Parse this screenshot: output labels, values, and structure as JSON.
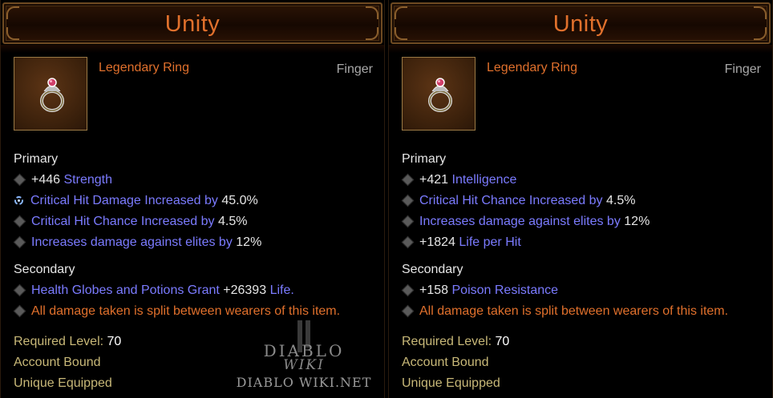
{
  "cards": [
    {
      "title": "Unity",
      "item_type": "Legendary Ring",
      "slot": "Finger",
      "primary_label": "Primary",
      "primary": [
        {
          "value": "+446",
          "text": "Strength",
          "icon": "diamond-bullet"
        },
        {
          "text": "Critical Hit Damage Increased by",
          "value": "45.0%",
          "icon": "gem-socket"
        },
        {
          "text": "Critical Hit Chance Increased by",
          "value": "4.5%",
          "icon": "diamond-bullet"
        },
        {
          "text": "Increases damage against elites by",
          "value": "12%",
          "icon": "diamond-bullet"
        }
      ],
      "secondary_label": "Secondary",
      "secondary": [
        {
          "text": "Health Globes and Potions Grant",
          "value": "+26393",
          "suffix": "Life."
        },
        {
          "text": "All damage taken is split between wearers of this item."
        }
      ],
      "required_level_label": "Required Level:",
      "required_level": "70",
      "bound": "Account Bound",
      "unique": "Unique Equipped"
    },
    {
      "title": "Unity",
      "item_type": "Legendary Ring",
      "slot": "Finger",
      "primary_label": "Primary",
      "primary": [
        {
          "value": "+421",
          "text": "Intelligence"
        },
        {
          "text": "Critical Hit Chance Increased by",
          "value": "4.5%"
        },
        {
          "text": "Increases damage against elites by",
          "value": "12%"
        },
        {
          "value": "+1824",
          "text": "Life per Hit"
        }
      ],
      "secondary_label": "Secondary",
      "secondary": [
        {
          "value": "+158",
          "text": "Poison Resistance"
        },
        {
          "text": "All damage taken is split between wearers of this item."
        }
      ],
      "required_level_label": "Required Level:",
      "required_level": "70",
      "bound": "Account Bound",
      "unique": "Unique Equipped"
    }
  ],
  "watermark": {
    "title": "DIABLO",
    "wiki": "WIKI",
    "url": "DIABLO WIKI.NET"
  },
  "colors": {
    "title": "#e0702c",
    "affix": "#7b7bff",
    "special": "#e0702c",
    "meta": "#c8b878",
    "frame": "#6e4a22"
  }
}
